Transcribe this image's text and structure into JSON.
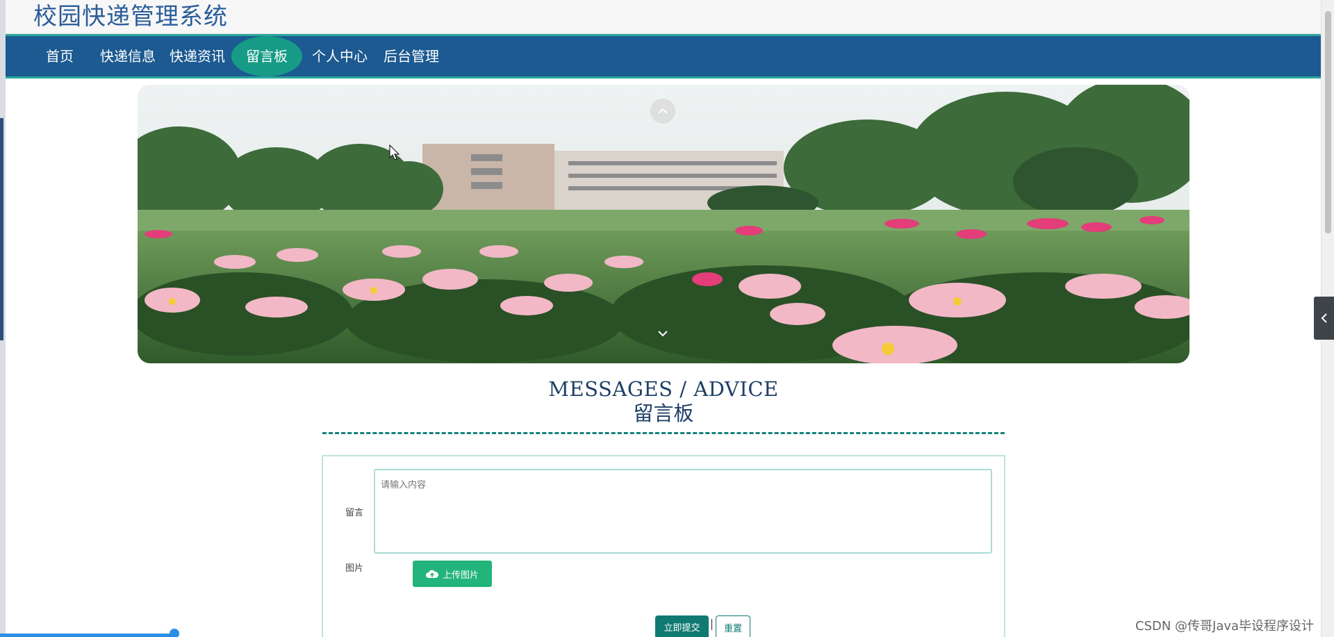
{
  "header": {
    "site_title": "校园快递管理系统"
  },
  "nav": {
    "items": [
      {
        "label": "首页"
      },
      {
        "label": "快递信息"
      },
      {
        "label": "快递资讯"
      },
      {
        "label": "留言板",
        "active": true
      },
      {
        "label": "个人中心"
      },
      {
        "label": "后台管理"
      }
    ]
  },
  "section": {
    "title_en": "MESSAGES / ADVICE",
    "title_cn": "留言板"
  },
  "form": {
    "message_label": "留言",
    "message_placeholder": "请输入内容",
    "image_label": "图片",
    "upload_label": "上传图片",
    "submit_label": "立即提交",
    "reset_label": "重置"
  },
  "watermark": "CSDN @传哥Java毕设程序设计",
  "colors": {
    "nav_bg": "#1c5a91",
    "nav_active": "#169b87",
    "accent": "#107a72",
    "upload": "#22b47a"
  }
}
